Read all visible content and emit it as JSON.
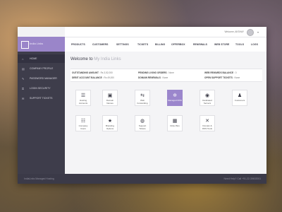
{
  "brand": {
    "name": "India Links"
  },
  "topbar": {
    "welcome": "Welcome, AKSHAY",
    "caret": "▾"
  },
  "nav": {
    "items": [
      "PRODUCTS",
      "CUSTOMERS",
      "SETTINGS",
      "TICKETS",
      "BILLING",
      "OFFERBOX",
      "RENEWALS",
      "WEB STORE",
      "TOOLS",
      "LOGS"
    ]
  },
  "sidebar": {
    "items": [
      {
        "icon": "⌂",
        "label": "HOME"
      },
      {
        "icon": "▤",
        "label": "COMPANY PROFILE"
      },
      {
        "icon": "✎",
        "label": "PASSWORD MANAGER"
      },
      {
        "icon": "⚿",
        "label": "LOGIN SECURITY"
      },
      {
        "icon": "✉",
        "label": "SUPPORT TICKETS"
      }
    ]
  },
  "main": {
    "welcome_prefix": "Welcome to",
    "welcome_name": "My India Links"
  },
  "info": {
    "outstanding_label": "OUTSTANDING AMOUNT",
    "outstanding_value": ": Rs 3,52,000",
    "pending_label": "PENDING LIVING ORDERS",
    "pending_value": ": None",
    "rewards_label": "WEB REWARDS BALANCE",
    "rewards_value": ": 0",
    "debit_label": "DEBIT ACCOUNT BALANCE",
    "debit_value": ": Rs 49,000",
    "renewals_label": "DOMAIN RENEWALS",
    "renewals_value": ": None",
    "support_label": "OPEN SUPPORT TICKETS",
    "support_value": ": None"
  },
  "tiles": [
    {
      "icon": "☰",
      "label": "Hosting Accounts",
      "active": false
    },
    {
      "icon": "▣",
      "label": "Domain Names",
      "active": false
    },
    {
      "icon": "⇆",
      "label": "Web Forwarding",
      "active": false
    },
    {
      "icon": "✲",
      "label": "Managed DNS",
      "active": true
    },
    {
      "icon": "◉",
      "label": "Dedicated Servers",
      "active": false
    },
    {
      "icon": "♟",
      "label": "Customers",
      "active": false
    },
    {
      "icon": "☷",
      "label": "Company Users",
      "active": false
    },
    {
      "icon": "★",
      "label": "Branding Options",
      "active": false
    },
    {
      "icon": "◍",
      "label": "Support Tickets",
      "active": false
    },
    {
      "icon": "▦",
      "label": "Order Box",
      "active": false
    },
    {
      "icon": "✕",
      "label": "Domain & DNS Tools",
      "active": false
    }
  ],
  "footer": {
    "left": "IndiaLinks Managed Hosting",
    "right": "Need Help? Call +91-22-30602001"
  }
}
